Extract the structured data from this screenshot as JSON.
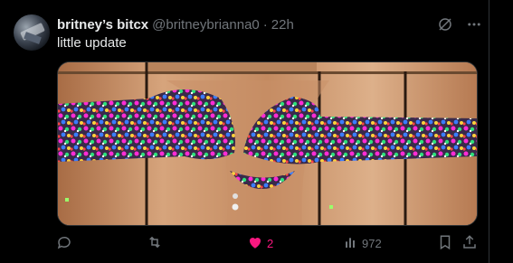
{
  "tweet": {
    "display_name": "britney’s bitcx",
    "handle": "@britneybrianna0",
    "separator": "·",
    "time": "22h",
    "text": "little update"
  },
  "icons": {
    "grok": "grok-icon",
    "more": "more-icon",
    "reply": "reply-icon",
    "retweet": "retweet-icon",
    "like": "heart-icon",
    "views": "views-icon",
    "bookmark": "bookmark-icon",
    "share": "share-icon"
  },
  "actions": {
    "reply_count": "",
    "retweet_count": "",
    "like_count": "2",
    "views_count": "972"
  },
  "colors": {
    "background": "#000000",
    "text": "#e7e9ea",
    "muted": "#71767b",
    "like": "#f91880"
  }
}
